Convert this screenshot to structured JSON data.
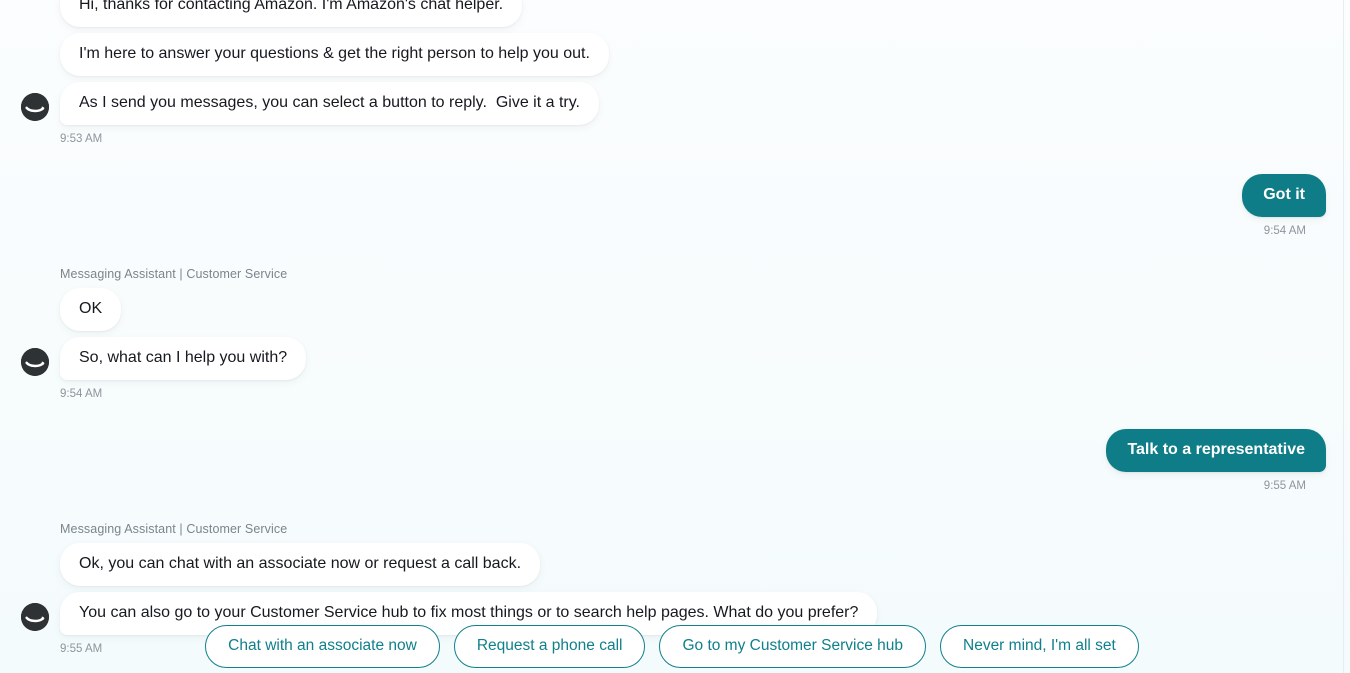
{
  "theme": {
    "accent_teal": "#0f7d87",
    "button_border_teal": "#11808b",
    "background": "#fafdfe",
    "bubble_bot_bg": "#ffffff",
    "text_primary": "#16191f",
    "text_muted": "#8d959c",
    "avatar_bg": "#2f3235"
  },
  "conversation": {
    "turns": [
      {
        "role": "bot",
        "sender_label": "",
        "avatar_icon": "amazon-smile-avatar-icon",
        "messages": [
          "Hi, thanks for contacting Amazon. I'm Amazon's chat helper.",
          "I'm here to answer your questions & get the right person to help you out.",
          "As I send you messages, you can select a button to reply.  Give it a try."
        ],
        "timestamp": "9:53 AM"
      },
      {
        "role": "user",
        "messages": [
          "Got it"
        ],
        "timestamp": "9:54 AM"
      },
      {
        "role": "bot",
        "sender_label": "Messaging Assistant | Customer Service",
        "avatar_icon": "amazon-smile-avatar-icon",
        "messages": [
          "OK",
          "So, what can I help you with?"
        ],
        "timestamp": "9:54 AM"
      },
      {
        "role": "user",
        "messages": [
          "Talk to a representative"
        ],
        "timestamp": "9:55 AM"
      },
      {
        "role": "bot",
        "sender_label": "Messaging Assistant | Customer Service",
        "avatar_icon": "amazon-smile-avatar-icon",
        "messages": [
          "Ok, you can chat with an associate now or request a call back.",
          "You can also go to your Customer Service hub to fix most things or to search help pages. What do you prefer?"
        ],
        "timestamp": "9:55 AM"
      }
    ]
  },
  "quick_replies": [
    {
      "label": "Chat with an associate now"
    },
    {
      "label": "Request a phone call"
    },
    {
      "label": "Go to my Customer Service hub"
    },
    {
      "label": "Never mind, I'm all set"
    }
  ]
}
